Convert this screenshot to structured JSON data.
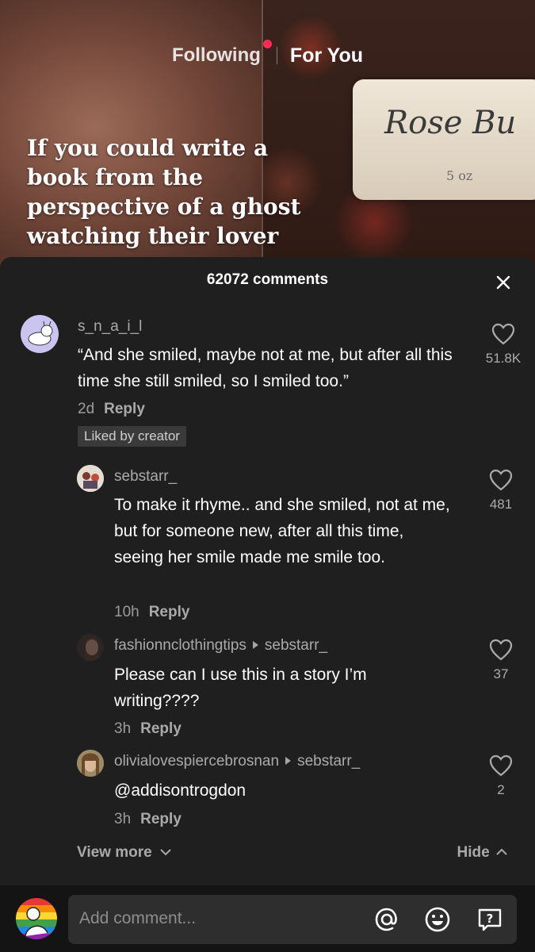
{
  "top_tabs": {
    "following": "Following",
    "for_you": "For You"
  },
  "video": {
    "caption": "If you could write a book from the perspective of a ghost watching their lover",
    "jar_label_line1": "Rose Bu",
    "jar_label_line2": "5 oz"
  },
  "comments_header": {
    "count_text": "62072 comments"
  },
  "comments": [
    {
      "username": "s_n_a_i_l",
      "text": "“And she smiled, maybe not at me, but after all this time she still smiled, so I smiled too.”",
      "time": "2d",
      "reply_label": "Reply",
      "badge": "Liked by creator",
      "likes": "51.8K"
    },
    {
      "username": "sebstarr_",
      "text": "To make it rhyme.. and she smiled, not at me, but for someone new, after all this time, seeing her smile made me smile too.",
      "time": "10h",
      "reply_label": "Reply",
      "likes": "481"
    },
    {
      "username": "fashionnclothingtips",
      "reply_to": "sebstarr_",
      "text": "Please can I use this in a story I’m writing????",
      "time": "3h",
      "reply_label": "Reply",
      "likes": "37"
    },
    {
      "username": "olivialovespiercebrosnan",
      "reply_to": "sebstarr_",
      "text": "@addisontrogdon",
      "time": "3h",
      "reply_label": "Reply",
      "likes": "2"
    }
  ],
  "view_more": "View more",
  "hide": "Hide",
  "input": {
    "placeholder": "Add comment..."
  },
  "colors": {
    "accent_red": "#fe2c55",
    "sheet_bg": "#1f1f1f",
    "input_bg": "#2e2e2e"
  }
}
